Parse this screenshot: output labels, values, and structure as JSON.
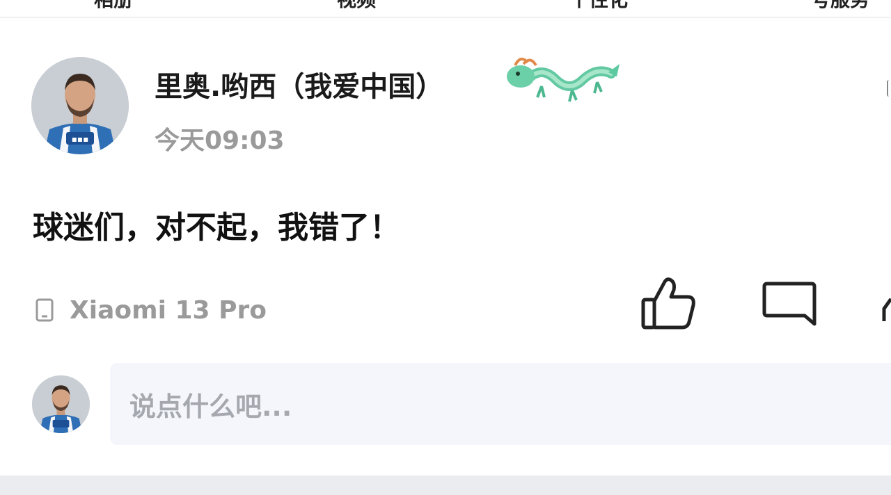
{
  "top_tabs": [
    "相册",
    "视频",
    "个性化",
    "号服务"
  ],
  "post": {
    "author_name": "里奥.哟西（我爱中国）",
    "time": "今天09:03",
    "text": "球迷们，对不起，我错了！",
    "device": "Xiaomi 13 Pro"
  },
  "comment": {
    "placeholder": "说点什么吧..."
  },
  "icons": {
    "device": "phone-icon",
    "like": "thumbs-up-icon",
    "comment": "comment-bubble-icon",
    "share": "share-icon"
  },
  "colors": {
    "name": "#1a1a1a",
    "meta_gray": "#9a9a9a",
    "input_bg": "#f4f6fb",
    "dragon_green": "#5cc9a0"
  }
}
